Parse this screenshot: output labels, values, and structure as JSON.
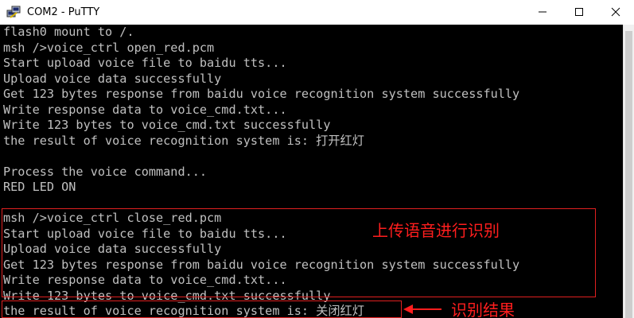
{
  "window": {
    "title": "COM2 - PuTTY",
    "icon": "putty-icon",
    "controls": [
      {
        "name": "minimize-button",
        "glyph": "—",
        "icon": "minimize-icon"
      },
      {
        "name": "maximize-button",
        "glyph": "☐",
        "icon": "maximize-icon"
      },
      {
        "name": "close-button",
        "glyph": "✕",
        "icon": "close-icon"
      }
    ]
  },
  "terminal": {
    "background": "#000000",
    "text_color": "#c0c0c0",
    "lines": [
      "flash0 mount to /.",
      "msh />voice_ctrl open_red.pcm",
      "Start upload voice file to baidu tts...",
      "Upload voice data successfully",
      "Get 123 bytes response from baidu voice recognition system successfully",
      "Write response data to voice_cmd.txt...",
      "Write 123 bytes to voice_cmd.txt successfully",
      "the result of voice recognition system is: 打开红灯",
      "",
      "Process the voice command...",
      "RED LED ON",
      "",
      "msh />voice_ctrl close_red.pcm",
      "Start upload voice file to baidu tts...",
      "Upload voice data successfully",
      "Get 123 bytes response from baidu voice recognition system successfully",
      "Write response data to voice_cmd.txt...",
      "Write 123 bytes to voice_cmd.txt successfully",
      "the result of voice recognition system is: 关闭红灯"
    ]
  },
  "annotations": {
    "color": "#ff1e1e",
    "upload_label": "上传语音进行识别",
    "result_label": "识别结果"
  }
}
